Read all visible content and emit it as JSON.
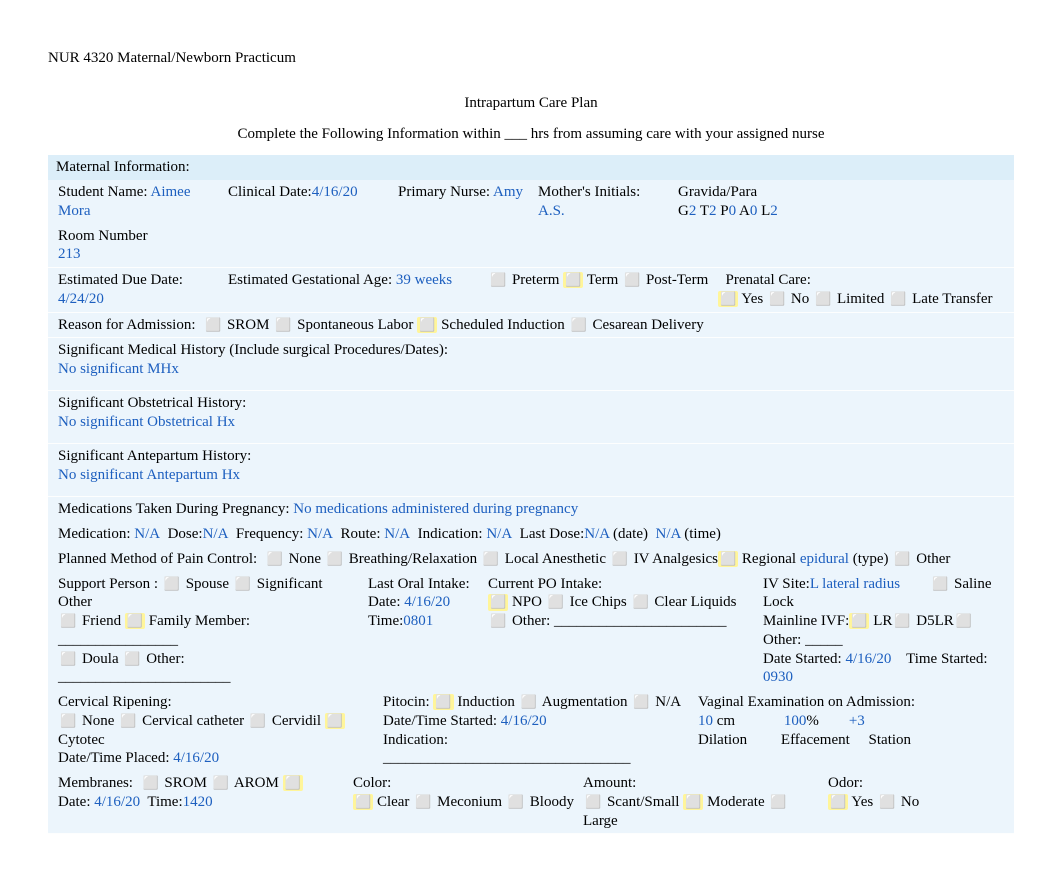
{
  "header": {
    "course": "NUR 4320 Maternal/Newborn Practicum",
    "title": "Intrapartum Care Plan",
    "subtitle": "Complete the Following Information within ___ hrs from assuming care with your assigned nurse"
  },
  "section_maternal": "Maternal Information:",
  "labels": {
    "student_name": "Student Name:",
    "clinical_date": "Clinical Date:",
    "primary_nurse": "Primary Nurse:",
    "mother_initials": "Mother's Initials:",
    "gravida_para": "Gravida/Para",
    "room_number": "Room Number",
    "edd": "Estimated Due Date:",
    "ega": "Estimated Gestational Age:",
    "preterm": "Preterm",
    "term": "Term",
    "postterm": "Post-Term",
    "prenatal_care": "Prenatal Care:",
    "pc_yes": "Yes",
    "pc_no": "No",
    "pc_limited": "Limited",
    "pc_late": "Late Transfer",
    "reason_admit": "Reason for Admission:",
    "ra_srom": "SROM",
    "ra_spont": "Spontaneous Labor",
    "ra_sched": "Scheduled Induction",
    "ra_cesarean": "Cesarean Delivery",
    "sig_med_hx": "Significant Medical History (Include surgical Procedures/Dates):",
    "sig_ob_hx": "Significant Obstetrical History:",
    "sig_ante_hx": "Significant Antepartum History:",
    "meds_pregnancy": "Medications Taken During Pregnancy:",
    "medication": "Medication:",
    "dose": "Dose:",
    "frequency": "Frequency:",
    "route": "Route:",
    "indication": "Indication:",
    "last_dose": "Last Dose:",
    "date_paren": "(date)",
    "time_paren": "(time)",
    "pain_method": "Planned Method of Pain Control:",
    "pm_none": "None",
    "pm_breath": "Breathing/Relaxation",
    "pm_local": "Local Anesthetic",
    "pm_iv": "IV Analgesics",
    "pm_regional": "Regional",
    "pm_type": "(type)",
    "pm_other": "Other",
    "support_person": "Support Person :",
    "sp_spouse": "Spouse",
    "sp_sig_other": "Significant Other",
    "sp_friend": "Friend",
    "sp_family": "Family Member: ________________",
    "sp_doula": "Doula",
    "sp_other": "Other: _______________________",
    "last_oral": "Last Oral Intake:",
    "loi_date": "Date:",
    "loi_time": "Time:",
    "cur_po": "Current PO Intake:",
    "po_npo": "NPO",
    "po_ice": "Ice Chips",
    "po_clear": "Clear Liquids",
    "po_other": "Other: _______________________",
    "iv_site": "IV Site:",
    "iv_saline": "Saline Lock",
    "iv_mainline": "Mainline IVF:",
    "iv_lr": "LR",
    "iv_d5lr": "D5LR",
    "iv_other": "Other:  _____",
    "iv_date_started": "Date Started:",
    "iv_time_started": "Time Started:",
    "cerv_ripening": "Cervical Ripening:",
    "cr_none": "None",
    "cr_cath": "Cervical catheter",
    "cr_cervidil": "Cervidil",
    "cr_cytotec": "Cytotec",
    "cr_dt_placed": " Date/Time Placed:",
    "pitocin": "Pitocin:",
    "pit_induction": "Induction",
    "pit_augment": "Augmentation",
    "pit_na": "N/A",
    "pit_dt_started": "Date/Time Started:",
    "pit_indication": "Indication:  _________________________________",
    "ve_admit": "Vaginal Examination on Admission:",
    "ve_cm": "cm",
    "ve_pct": "%",
    "ve_dilation": "Dilation",
    "ve_efface": "Effacement",
    "ve_station": "Station",
    "membranes": "Membranes:",
    "mem_srom": "SROM",
    "mem_arom": "AROM",
    "mem_date": "Date:",
    "mem_time": "Time:",
    "color": "Color:",
    "col_clear": "Clear",
    "col_mec": "Meconium",
    "col_bloody": "Bloody",
    "amount": "Amount:",
    "amt_scant": "Scant/Small",
    "amt_mod": "Moderate",
    "amt_lrg": "Large",
    "odor": "Odor:",
    "odor_yes": "Yes",
    "odor_no": "No",
    "g": "G",
    "t": "T",
    "p": "P",
    "a": "A",
    "l": "L"
  },
  "values": {
    "student_name": "Aimee Mora",
    "clinical_date": "4/16/20",
    "primary_nurse": "Amy",
    "mother_initials": "A.S.",
    "g": "2",
    "t": "2",
    "p": "0",
    "a": "0",
    "l": "2",
    "room_number": "213",
    "edd": "4/24/20",
    "ega": "39 weeks",
    "sig_med_hx": "No significant MHx",
    "sig_ob_hx": "No significant Obstetrical Hx",
    "sig_ante_hx": "No significant Antepartum Hx",
    "meds_pregnancy": "No medications administered during pregnancy",
    "medication": "N/A",
    "dose": "N/A",
    "frequency": "N/A",
    "route": "N/A",
    "indication": "N/A",
    "last_dose_date": "N/A",
    "last_dose_time": "N/A",
    "pain_type": "epidural",
    "loi_date": "4/16/20",
    "loi_time": "0801",
    "iv_site": "L lateral radius",
    "iv_date_started": "4/16/20",
    "iv_time_started": "0930",
    "cr_dt_placed": "4/16/20",
    "pit_dt_started": "4/16/20",
    "ve_dilation": "10",
    "ve_efface": "100",
    "ve_station": "+3",
    "mem_date": "4/16/20",
    "mem_time": "1420"
  }
}
